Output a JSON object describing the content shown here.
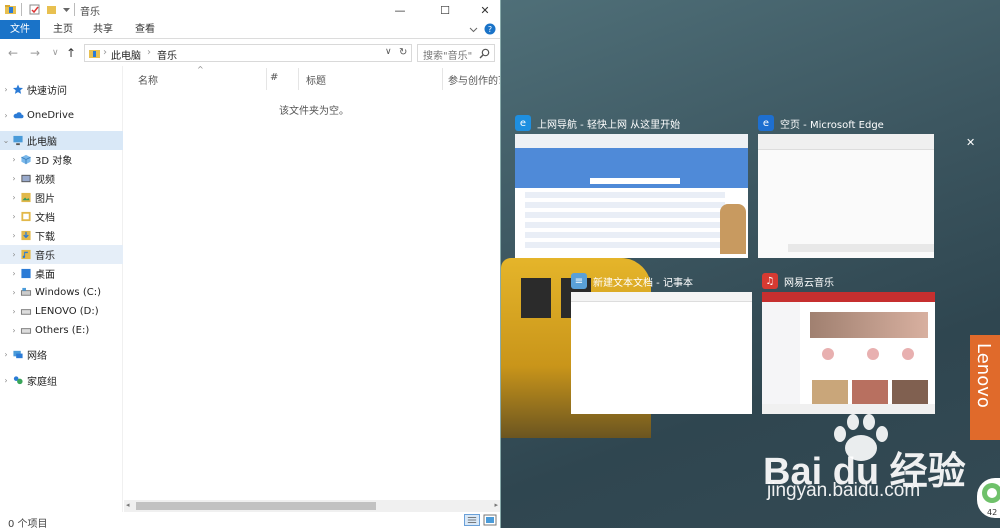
{
  "explorer": {
    "title": "音乐",
    "window_controls": [
      "—",
      "☐",
      "✕"
    ],
    "ribbon": {
      "tabs": [
        "文件",
        "主页",
        "共享",
        "查看"
      ]
    },
    "address": {
      "back": "←",
      "forward": "→",
      "dropdown": "∨",
      "up": "↑",
      "path": [
        "此电脑",
        "音乐"
      ],
      "refresh": "↻"
    },
    "search": {
      "placeholder": "搜索\"音乐\""
    },
    "nav": [
      {
        "label": "快速访问",
        "icon": "star-icon",
        "color": "#2b7bd6"
      },
      {
        "label": "OneDrive",
        "icon": "cloud-icon",
        "color": "#2b7bd6"
      },
      {
        "label": "此电脑",
        "icon": "computer-icon",
        "color": "#4a9bd9"
      },
      {
        "label": "3D 对象",
        "icon": "cube-icon",
        "color": "#4aa0e0"
      },
      {
        "label": "视频",
        "icon": "video-icon",
        "color": "#6b6b6b"
      },
      {
        "label": "图片",
        "icon": "picture-icon",
        "color": "#e2b84a"
      },
      {
        "label": "文档",
        "icon": "document-icon",
        "color": "#e2b84a"
      },
      {
        "label": "下载",
        "icon": "download-icon",
        "color": "#2b7bd6"
      },
      {
        "label": "音乐",
        "icon": "music-icon",
        "color": "#2b7bd6"
      },
      {
        "label": "桌面",
        "icon": "desktop-icon",
        "color": "#2b7bd6"
      },
      {
        "label": "Windows (C:)",
        "icon": "drive-icon",
        "color": "#4a9bd9"
      },
      {
        "label": "LENOVO (D:)",
        "icon": "drive-icon",
        "color": "#777777"
      },
      {
        "label": "Others (E:)",
        "icon": "drive-icon",
        "color": "#777777"
      },
      {
        "label": "网络",
        "icon": "network-icon",
        "color": "#2b7bd6"
      },
      {
        "label": "家庭组",
        "icon": "homegroup-icon",
        "color": "#3aa55a"
      }
    ],
    "columns": [
      "名称",
      "#",
      "标题",
      "参与创作的艺"
    ],
    "empty_message": "该文件夹为空。",
    "status": "0 个项目"
  },
  "snap": {
    "tiles": [
      {
        "title": "上网导航 - 轻快上网 从这里开始",
        "icon": "ie-icon",
        "icon_color": "#1e8fe0"
      },
      {
        "title": "空页 - Microsoft Edge",
        "icon": "edge-icon",
        "icon_color": "#1e6fd0"
      },
      {
        "title": "新建文本文档 - 记事本",
        "icon": "notepad-icon",
        "icon_color": "#5aa0d8"
      },
      {
        "title": "网易云音乐",
        "icon": "netease-music-icon",
        "icon_color": "#d63a32"
      }
    ],
    "close_glyph": "✕",
    "wallpaper_brand": "Lenovo",
    "watermark": {
      "logo": "Bai du 经验",
      "url": "jingyan.baidu.com"
    },
    "badge": "42"
  },
  "colors": {
    "accent": "#1a73c8",
    "selected_bg": "#d9e8f7"
  }
}
